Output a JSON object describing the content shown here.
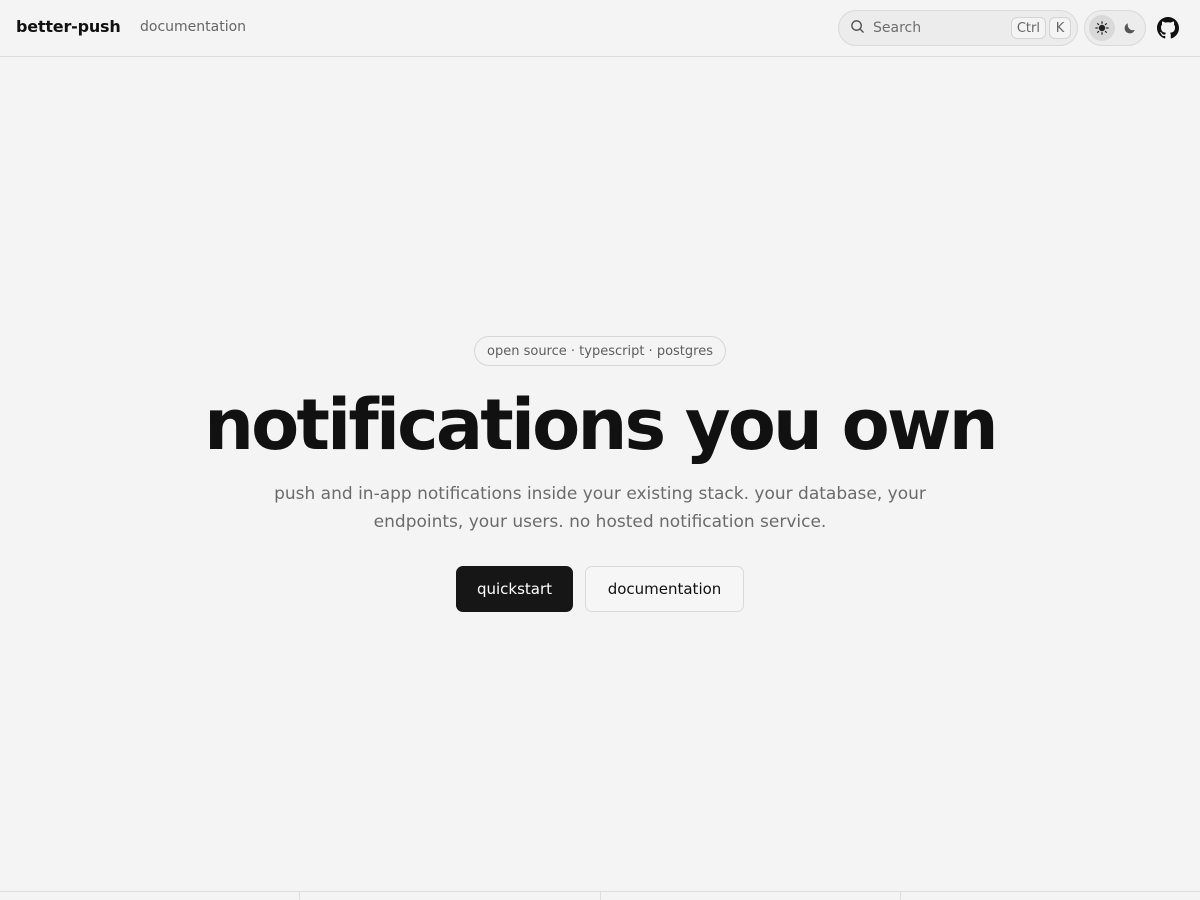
{
  "nav": {
    "brand": "better-push",
    "links": [
      {
        "label": "documentation"
      }
    ],
    "search": {
      "label": "Search",
      "shortcut": [
        "Ctrl",
        "K"
      ],
      "icon": "search-icon"
    },
    "theme_toggle": {
      "options": [
        "light",
        "dark"
      ],
      "active": "light"
    },
    "github_icon": "github-icon"
  },
  "hero": {
    "badge": "open source · typescript · postgres",
    "title": "notifications you own",
    "subtitle": "push and in-app notifications inside your existing stack. your database, your endpoints, your users. no hosted notification service.",
    "primary_cta": "quickstart",
    "secondary_cta": "documentation"
  },
  "colors": {
    "background": "#f4f4f4",
    "text": "#111111",
    "muted": "#6b6b6b",
    "primary_button": "#161616",
    "border": "#dedede"
  }
}
